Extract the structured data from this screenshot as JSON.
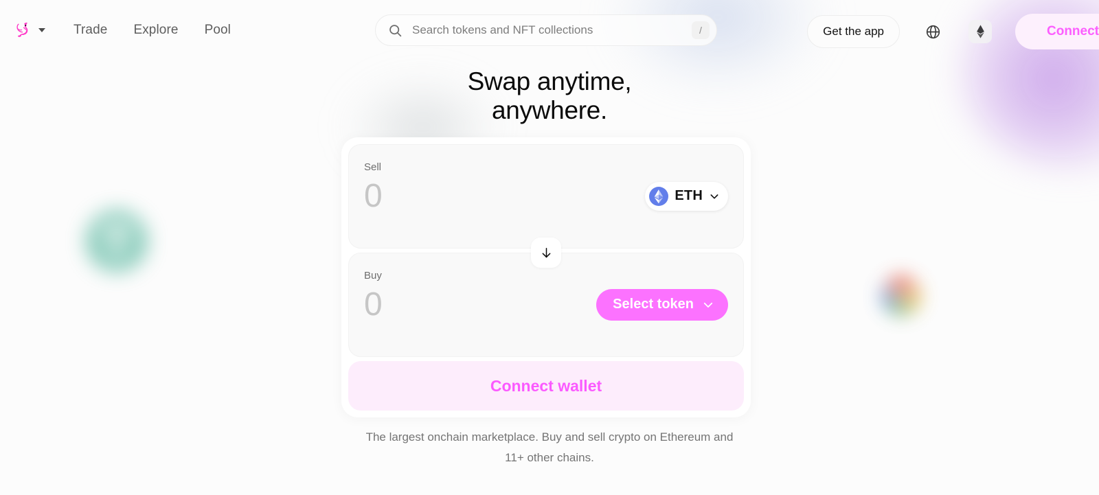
{
  "nav": {
    "logo_icon": "unicorn-logo",
    "logo_caret_icon": "chevron-down-icon",
    "links": [
      {
        "label": "Trade"
      },
      {
        "label": "Explore"
      },
      {
        "label": "Pool"
      }
    ],
    "get_app_label": "Get the app",
    "globe_icon": "globe-icon",
    "chain_icon": "ethereum-icon",
    "connect_label": "Connect"
  },
  "search": {
    "placeholder": "Search tokens and NFT collections",
    "value": "",
    "icon": "search-icon",
    "shortcut_key": "/"
  },
  "hero": {
    "line1": "Swap anytime,",
    "line2": "anywhere."
  },
  "swap": {
    "sell": {
      "label": "Sell",
      "amount_placeholder": "0",
      "amount_value": "",
      "token_symbol": "ETH",
      "token_icon": "ethereum-token-icon",
      "chevron_icon": "chevron-down-icon"
    },
    "switch_icon": "arrow-down-icon",
    "buy": {
      "label": "Buy",
      "amount_placeholder": "0",
      "amount_value": "",
      "select_token_label": "Select token",
      "chevron_icon": "chevron-down-icon"
    },
    "connect_wallet_label": "Connect wallet"
  },
  "tagline": "The largest onchain marketplace. Buy and sell crypto on Ethereum and 11+ other chains.",
  "colors": {
    "accent_pink": "#FC72FF",
    "connect_text": "#FB5AFF",
    "connect_bg": "#FDEDFC",
    "eth_blue": "#627EEA",
    "page_bg": "#FCFCFC",
    "panel_bg": "#F9F9F9"
  }
}
